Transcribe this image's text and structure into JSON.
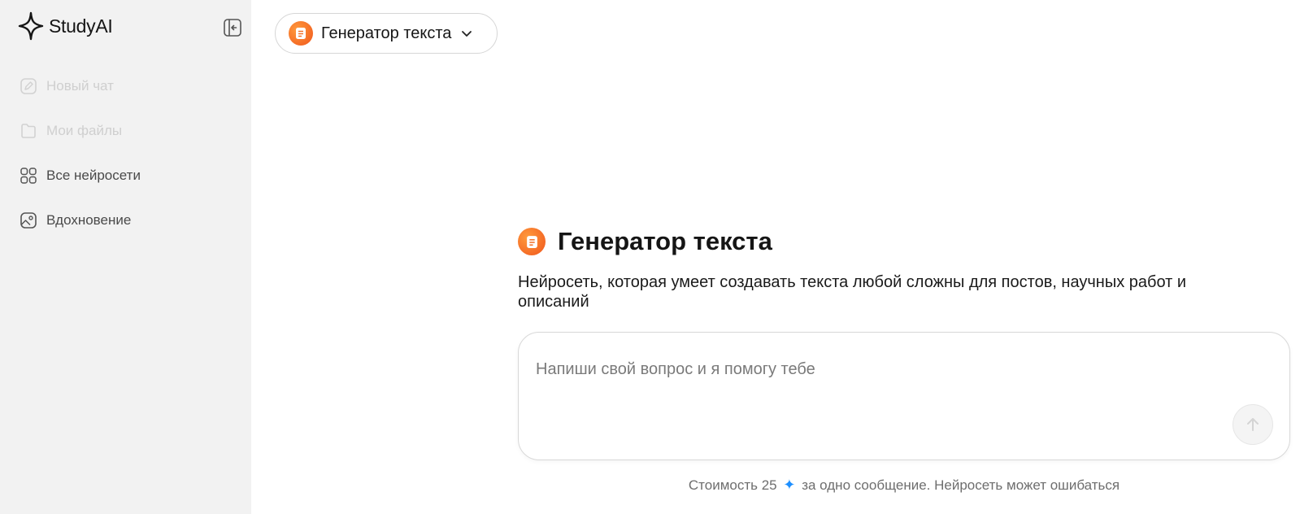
{
  "app": {
    "name": "StudyAI"
  },
  "sidebar": {
    "items": [
      {
        "label": "Новый чат",
        "icon": "edit-icon",
        "state": "disabled"
      },
      {
        "label": "Мои файлы",
        "icon": "folder-icon",
        "state": "disabled"
      },
      {
        "label": "Все нейросети",
        "icon": "grid-icon",
        "state": "active"
      },
      {
        "label": "Вдохновение",
        "icon": "image-icon",
        "state": "active"
      }
    ]
  },
  "model_selector": {
    "label": "Генератор текста",
    "icon": "document-icon"
  },
  "hero": {
    "title": "Генератор текста",
    "description": "Нейросеть, которая умеет создавать текста любой сложны для постов, научных работ и описаний"
  },
  "input": {
    "placeholder": "Напиши свой вопрос и я помогу тебе",
    "value": ""
  },
  "footer": {
    "cost_prefix": "Стоимость 25",
    "cost_icon": "✦",
    "cost_suffix": "за одно сообщение. Нейросеть может ошибаться"
  },
  "colors": {
    "accent_orange": "#f26b21",
    "gem_blue": "#1d8fff",
    "sidebar_bg": "#f2f2f2"
  }
}
